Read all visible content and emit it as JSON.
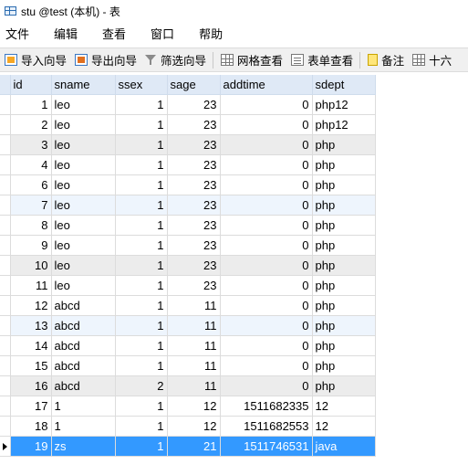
{
  "window": {
    "title": "stu @test (本机) - 表"
  },
  "menu": {
    "items": [
      "文件",
      "编辑",
      "查看",
      "窗口",
      "帮助"
    ]
  },
  "toolbar": {
    "import_label": "导入向导",
    "export_label": "导出向导",
    "filter_label": "筛选向导",
    "grid_view_label": "网格查看",
    "form_view_label": "表单查看",
    "memo_label": "备注",
    "hex_label": "十六"
  },
  "table": {
    "columns": [
      "id",
      "sname",
      "ssex",
      "sage",
      "addtime",
      "sdept"
    ],
    "rows": [
      [
        "1",
        "leo",
        "1",
        "23",
        "0",
        "php12"
      ],
      [
        "2",
        "leo",
        "1",
        "23",
        "0",
        "php12"
      ],
      [
        "3",
        "leo",
        "1",
        "23",
        "0",
        "php"
      ],
      [
        "4",
        "leo",
        "1",
        "23",
        "0",
        "php"
      ],
      [
        "6",
        "leo",
        "1",
        "23",
        "0",
        "php"
      ],
      [
        "7",
        "leo",
        "1",
        "23",
        "0",
        "php"
      ],
      [
        "8",
        "leo",
        "1",
        "23",
        "0",
        "php"
      ],
      [
        "9",
        "leo",
        "1",
        "23",
        "0",
        "php"
      ],
      [
        "10",
        "leo",
        "1",
        "23",
        "0",
        "php"
      ],
      [
        "11",
        "leo",
        "1",
        "23",
        "0",
        "php"
      ],
      [
        "12",
        "abcd",
        "1",
        "11",
        "0",
        "php"
      ],
      [
        "13",
        "abcd",
        "1",
        "11",
        "0",
        "php"
      ],
      [
        "14",
        "abcd",
        "1",
        "11",
        "0",
        "php"
      ],
      [
        "15",
        "abcd",
        "1",
        "11",
        "0",
        "php"
      ],
      [
        "16",
        "abcd",
        "2",
        "11",
        "0",
        "php"
      ],
      [
        "17",
        "1",
        "1",
        "12",
        "1511682335",
        "12"
      ],
      [
        "18",
        "1",
        "1",
        "12",
        "1511682553",
        "12"
      ],
      [
        "19",
        "zs",
        "1",
        "21",
        "1511746531",
        "java"
      ]
    ],
    "row_styles": [
      "",
      "",
      "alt-gray",
      "",
      "",
      "alt-blue",
      "",
      "",
      "alt-gray",
      "",
      "",
      "alt-blue",
      "",
      "",
      "alt-gray",
      "",
      "",
      "selected"
    ]
  },
  "colors": {
    "header_bg": "#dfe9f6",
    "selected_bg": "#3399ff",
    "alt_gray": "#ececec",
    "alt_blue": "#eef5fd"
  }
}
